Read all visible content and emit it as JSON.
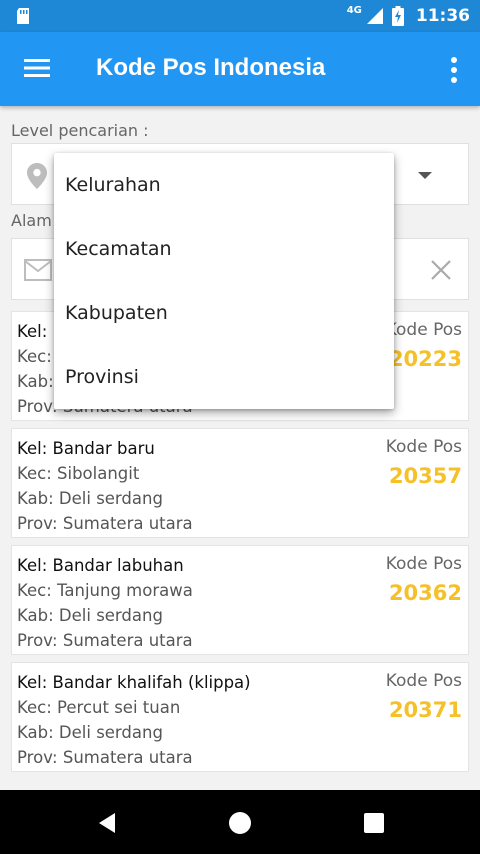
{
  "status_bar": {
    "network": "4G",
    "time": "11:36",
    "icons": [
      "sd-card-icon",
      "signal-icon",
      "battery-charging-icon"
    ]
  },
  "app_bar": {
    "title": "Kode Pos Indonesia",
    "icons": [
      "menu-icon",
      "more-vert-icon"
    ]
  },
  "search": {
    "level_label": "Level pencarian :",
    "address_label_visible": "Alam",
    "icons": [
      "location-pin-icon",
      "dropdown-caret-icon",
      "mail-icon",
      "clear-icon"
    ]
  },
  "dropdown": {
    "options": [
      "Kelurahan",
      "Kecamatan",
      "Kabupaten",
      "Provinsi"
    ]
  },
  "results": [
    {
      "kel": "Kel: I",
      "kec": "Kec:",
      "kab": "Kab:",
      "prov": "Prov: Sumatera utara",
      "kode_label": "Kode Pos",
      "kode": "20223"
    },
    {
      "kel": "Kel: Bandar baru",
      "kec": "Kec: Sibolangit",
      "kab": "Kab: Deli serdang",
      "prov": "Prov: Sumatera utara",
      "kode_label": "Kode Pos",
      "kode": "20357"
    },
    {
      "kel": "Kel: Bandar labuhan",
      "kec": "Kec: Tanjung morawa",
      "kab": "Kab: Deli serdang",
      "prov": "Prov: Sumatera utara",
      "kode_label": "Kode Pos",
      "kode": "20362"
    },
    {
      "kel": "Kel: Bandar khalifah (klippa)",
      "kec": "Kec: Percut sei tuan",
      "kab": "Kab: Deli serdang",
      "prov": "Prov: Sumatera utara",
      "kode_label": "Kode Pos",
      "kode": "20371"
    }
  ],
  "nav_bar": {
    "icons": [
      "back-icon",
      "home-icon",
      "recents-icon"
    ]
  },
  "colors": {
    "primary": "#2196f3",
    "status_bar": "#1e88d6",
    "postal_code": "#f5c028"
  }
}
